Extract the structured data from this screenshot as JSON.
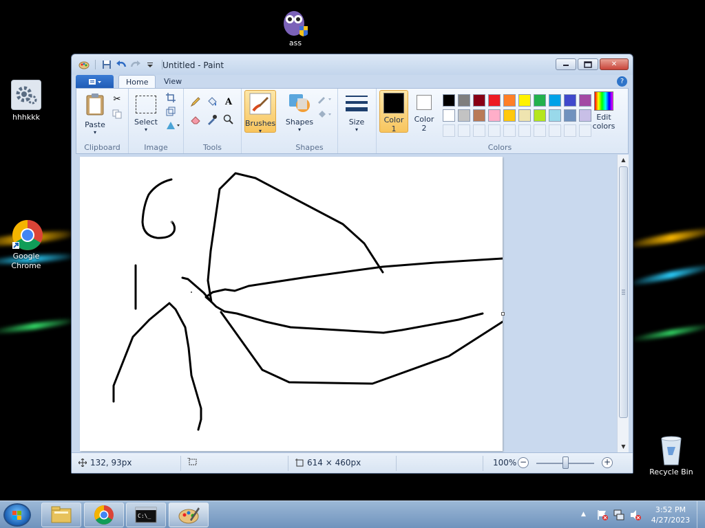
{
  "desktop": {
    "icons": [
      {
        "label": "ass"
      },
      {
        "label": "hhhkkk"
      },
      {
        "label": "Google Chrome"
      },
      {
        "label": "Recycle Bin"
      }
    ]
  },
  "window": {
    "title": "Untitled - Paint",
    "tabs": {
      "home": "Home",
      "view": "View"
    },
    "ribbon": {
      "clipboard": {
        "group_label": "Clipboard",
        "paste_label": "Paste"
      },
      "image": {
        "group_label": "Image",
        "select_label": "Select"
      },
      "tools": {
        "group_label": "Tools"
      },
      "brushes": {
        "label": "Brushes"
      },
      "shapes": {
        "group_label": "Shapes",
        "label": "Shapes"
      },
      "size": {
        "label": "Size"
      },
      "colors": {
        "group_label": "Colors",
        "color1_line1": "Color",
        "color1_line2": "1",
        "color2_line1": "Color",
        "color2_line2": "2",
        "edit_line1": "Edit",
        "edit_line2": "colors",
        "color1_value": "#000000",
        "color2_value": "#ffffff",
        "palette_row1": [
          "#000000",
          "#7f7f7f",
          "#880015",
          "#ed1c24",
          "#ff7f27",
          "#fff200",
          "#22b14c",
          "#00a2e8",
          "#3f48cc",
          "#a349a4"
        ],
        "palette_row2": [
          "#ffffff",
          "#c3c3c3",
          "#b97a57",
          "#ffaec9",
          "#ffc90e",
          "#efe4b0",
          "#b5e61d",
          "#99d9ea",
          "#7092be",
          "#c8bfe7"
        ]
      }
    },
    "status": {
      "cursor_pos": "132, 93px",
      "canvas_size": "614 × 460px",
      "zoom": "100%"
    }
  },
  "taskbar": {
    "time": "3:52 PM",
    "date": "4/27/2023"
  }
}
